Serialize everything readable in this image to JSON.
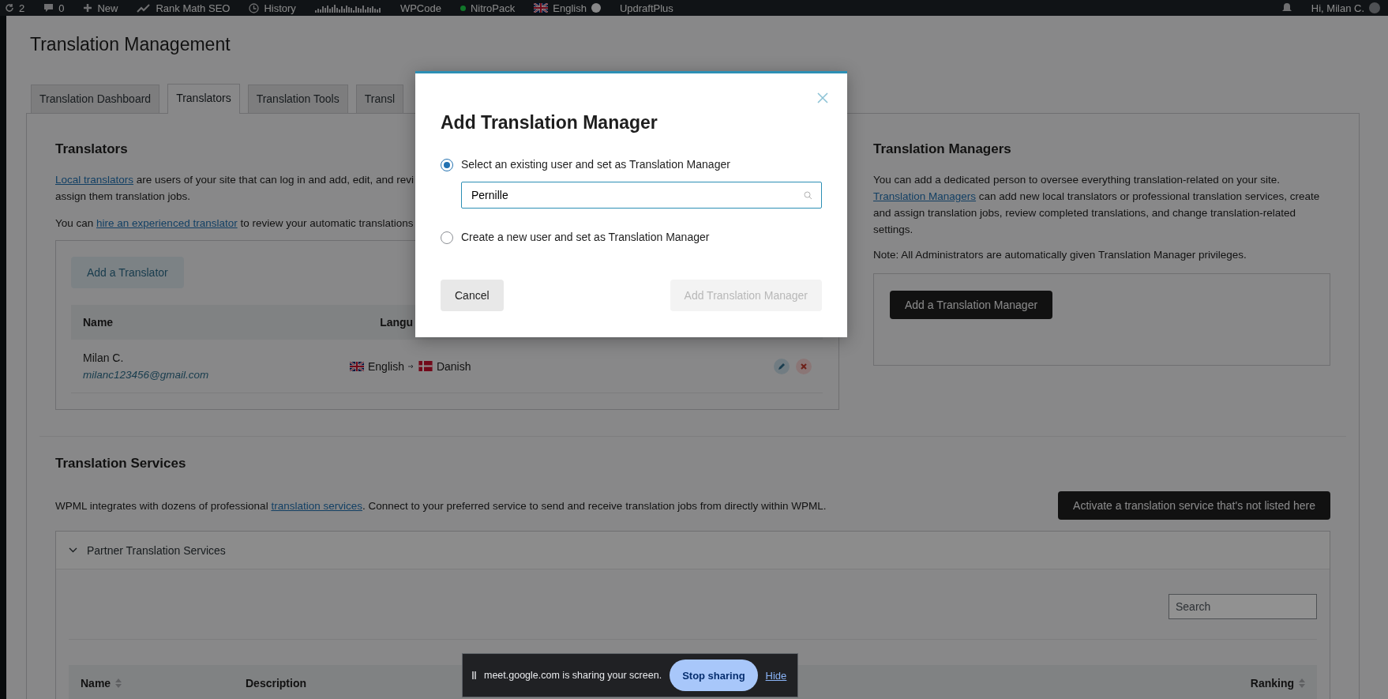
{
  "admin_bar": {
    "left": [
      {
        "kind": "updates",
        "label": "2"
      },
      {
        "kind": "comments",
        "label": "0"
      },
      {
        "kind": "new",
        "label": "New"
      },
      {
        "kind": "seo",
        "label": "Rank Math SEO"
      },
      {
        "kind": "history",
        "label": "History"
      },
      {
        "kind": "sparkline"
      },
      {
        "kind": "plain",
        "label": "WPCode"
      },
      {
        "kind": "status",
        "label": "NitroPack"
      },
      {
        "kind": "language",
        "label": "English"
      },
      {
        "kind": "plain",
        "label": "UpdraftPlus"
      }
    ],
    "greeting": "Hi, Milan C."
  },
  "page_title": "Translation Management",
  "tabs": [
    {
      "label": "Translation Dashboard",
      "selected": false
    },
    {
      "label": "Translators",
      "selected": true
    },
    {
      "label": "Translation Tools",
      "selected": false
    },
    {
      "label": "Transl",
      "selected": false
    }
  ],
  "translators": {
    "heading": "Translators",
    "intro_link": "Local translators",
    "intro_rest": " are users of your site that can log in and add, edit, and revi",
    "intro_line2": "assign them translation jobs.",
    "hire_before": "You can ",
    "hire_link": "hire an experienced translator",
    "hire_after": " to review your automatic translations",
    "add_button": "Add a Translator",
    "columns": [
      "Name",
      "Langu"
    ],
    "rows": [
      {
        "name": "Milan C.",
        "email": "milanc123456@gmail.com",
        "from": "English",
        "to": "Danish"
      }
    ]
  },
  "managers": {
    "heading": "Translation Managers",
    "line1": "You can add a dedicated person to oversee everything translation-related on your site.",
    "link": "Translation Managers",
    "rest": " can add new local translators or professional translation services, create and assign translation jobs, review completed translations, and change translation-related settings.",
    "note": "Note: All Administrators are automatically given Translation Manager privileges.",
    "button": "Add a Translation Manager"
  },
  "services": {
    "heading": "Translation Services",
    "text_before": "WPML integrates with dozens of professional ",
    "text_link": "translation services",
    "text_after": ". Connect to your preferred service to send and receive translation jobs from directly within WPML.",
    "button": "Activate a translation service that's not listed here",
    "partner": {
      "title": "Partner Translation Services",
      "expanded": true,
      "search_placeholder": "Search",
      "columns": [
        {
          "label": "Name",
          "sortable": true
        },
        {
          "label": "Description",
          "sortable": false
        },
        {
          "label": "Ranking",
          "sortable": true
        }
      ]
    }
  },
  "modal": {
    "title": "Add Translation Manager",
    "options": [
      {
        "label": "Select an existing user and set as Translation Manager",
        "selected": true
      },
      {
        "label": "Create a new user and set as Translation Manager",
        "selected": false
      }
    ],
    "user_field": "Pernille",
    "buttons": [
      {
        "label": "Cancel",
        "kind": "secondary",
        "disabled": false
      },
      {
        "label": "Add Translation Manager",
        "kind": "primary",
        "disabled": true
      }
    ]
  },
  "share_bar": {
    "message": "meet.google.com is sharing your screen.",
    "stop": "Stop sharing",
    "hide": "Hide"
  }
}
